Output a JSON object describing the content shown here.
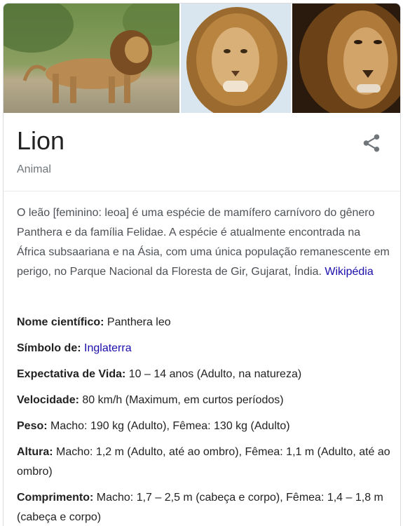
{
  "panel": {
    "title": "Lion",
    "subtitle": "Animal",
    "images": [
      {
        "alt": "lion-standing"
      },
      {
        "alt": "lion-portrait"
      },
      {
        "alt": "lion-closeup"
      }
    ],
    "description": "O leão [feminino: leoa] é uma espécie de mamífero carnívoro do gênero Panthera e da família Felidae. A espécie é atualmente encontrada na África subsaariana e na Ásia, com uma única população remanescente em perigo, no Parque Nacional da Floresta de Gir, Gujarat, Índia.",
    "source_link": "Wikipédia"
  },
  "facts": [
    {
      "label": "Nome científico:",
      "value": "Panthera leo"
    },
    {
      "label": "Símbolo de:",
      "link": "Inglaterra"
    },
    {
      "label": "Expectativa de Vida:",
      "value": "10 – 14 anos (Adulto, na natureza)"
    },
    {
      "label": "Velocidade:",
      "value": "80 km/h (Maximum, em curtos períodos)"
    },
    {
      "label": "Peso:",
      "value": "Macho: 190 kg (Adulto), Fêmea: 130 kg (Adulto)"
    },
    {
      "label": "Altura:",
      "value": "Macho: 1,2 m (Adulto, até ao ombro), Fêmea: 1,1 m (Adulto, até ao ombro)"
    },
    {
      "label": "Comprimento:",
      "value": "Macho: 1,7 – 2,5 m (cabeça e corpo), Fêmea: 1,4 – 1,8 m (cabeça e corpo)"
    }
  ],
  "colors": {
    "link": "#1a0dab",
    "title": "#222222",
    "subtitle": "#70757a",
    "body_text": "#4d5156",
    "border": "#dadce0"
  }
}
